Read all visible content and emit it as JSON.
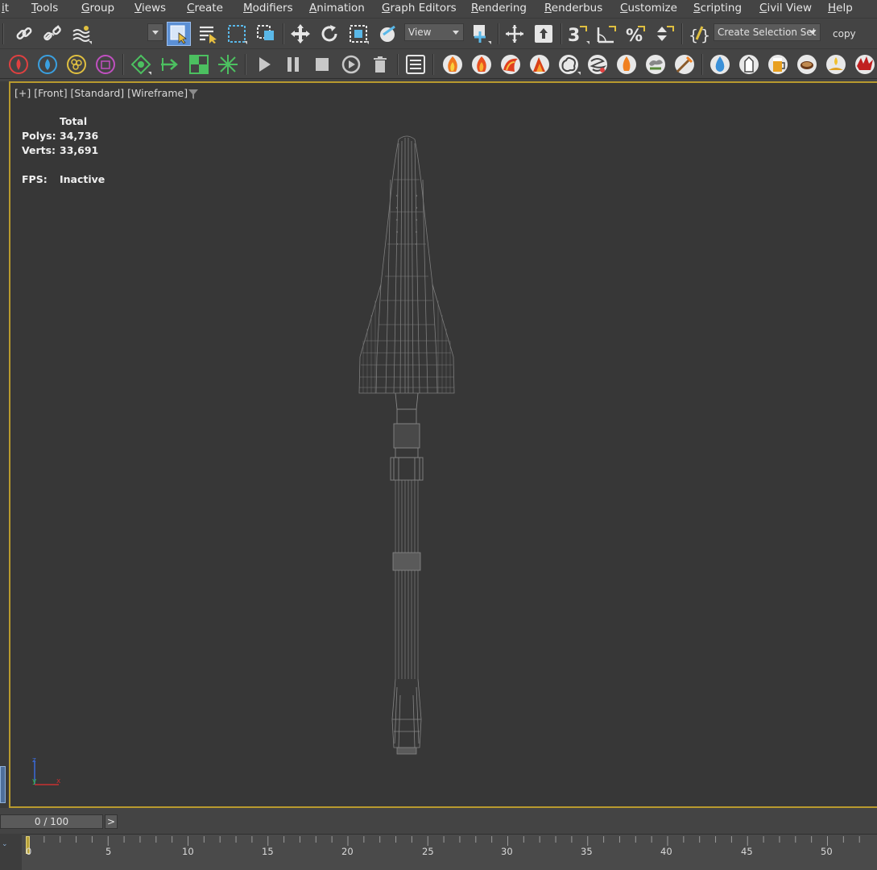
{
  "menu": {
    "items": [
      "it",
      "Tools",
      "Group",
      "Views",
      "Create",
      "Modifiers",
      "Animation",
      "Graph Editors",
      "Rendering",
      "Renderbus",
      "Customize",
      "Scripting",
      "Civil View",
      "Help"
    ]
  },
  "toolbar1": {
    "view_dropdown": "View",
    "selection_set": "Create Selection Set",
    "copy_label": "copy"
  },
  "viewport": {
    "label": "[+] [Front] [Standard] [Wireframe]",
    "stats": {
      "total_header": "Total",
      "polys_label": "Polys:",
      "polys_value": "34,736",
      "verts_label": "Verts:",
      "verts_value": "33,691",
      "fps_label": "FPS:",
      "fps_value": "Inactive"
    },
    "axis": {
      "z": "z",
      "y": "y",
      "x": "x"
    }
  },
  "timeline": {
    "slider_text": "0 / 100",
    "next_button": ">",
    "track_labels": [
      "0",
      "5",
      "10",
      "15",
      "20",
      "25",
      "30",
      "35",
      "40",
      "45",
      "50"
    ]
  },
  "colors": {
    "accent_border": "#b89a2e",
    "viewport_bg": "#373737",
    "ui_bg": "#444444",
    "selected_tool": "#5b8fd4"
  },
  "icons": {
    "toolbar1": [
      "link-icon",
      "unlink-icon",
      "bind-spacewarp-icon",
      "selection-filter-icon",
      "select-object-icon",
      "select-by-name-icon",
      "rect-region-icon",
      "window-crossing-icon",
      "move-icon",
      "rotate-icon",
      "scale-icon",
      "placement-icon",
      "pivot-icon",
      "snap-toggle-icon",
      "angle-snap-icon",
      "percent-snap-icon",
      "spinner-snap-icon",
      "edit-named-sets-icon"
    ],
    "toolbar2": [
      "fire-effect-icon",
      "water-effect-icon",
      "particle-icon",
      "box-effect-icon",
      "helper-icon",
      "arrow-icon",
      "checker-icon",
      "burst-icon",
      "play-icon",
      "pause-icon",
      "stop-icon",
      "replay-icon",
      "trash-icon",
      "list-icon",
      "flame-icon",
      "flame-icon",
      "flame-icon",
      "flame-icon",
      "smoke-icon",
      "smoke-icon",
      "drop-flame-icon",
      "swirl-icon",
      "brush-icon",
      "water-drop-icon",
      "milk-icon",
      "beer-icon",
      "coffee-icon",
      "splash-icon",
      "red-splash-icon"
    ]
  }
}
